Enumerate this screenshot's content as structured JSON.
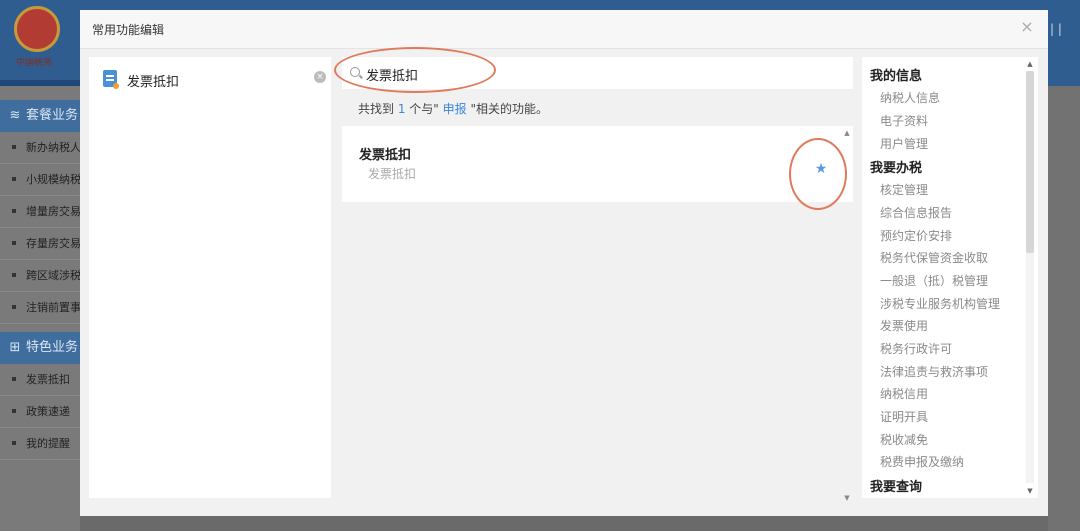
{
  "background": {
    "logo_text": "中国税务",
    "sections": [
      {
        "label": "套餐业务",
        "icon": "stack-icon"
      },
      {
        "label": "特色业务",
        "icon": "grid-icon"
      }
    ],
    "items_group1": [
      "新办纳税人",
      "小规模纳税",
      "增量房交易",
      "存量房交易",
      "跨区域涉税",
      "注销前置事"
    ],
    "items_group2": [
      "发票抵扣",
      "政策速递",
      "我的提醒"
    ]
  },
  "modal": {
    "title": "常用功能编辑",
    "close_icon": "×"
  },
  "favorites": [
    {
      "label": "发票抵扣",
      "icon": "document-icon"
    }
  ],
  "search": {
    "value": "发票抵扣"
  },
  "result_summary": {
    "prefix": "共找到 ",
    "count": "1",
    "middle": " 个与\" ",
    "keyword": "申报",
    "suffix": " \"相关的功能。"
  },
  "results": [
    {
      "title": "发票抵扣",
      "subtitle": "发票抵扣",
      "icon": "star-icon"
    }
  ],
  "categories": [
    {
      "heading": "我的信息",
      "items": [
        "纳税人信息",
        "电子资料",
        "用户管理"
      ]
    },
    {
      "heading": "我要办税",
      "items": [
        "核定管理",
        "综合信息报告",
        "预约定价安排",
        "税务代保管资金收取",
        "一般退（抵）税管理",
        "涉税专业服务机构管理",
        "发票使用",
        "税务行政许可",
        "法律追责与救济事项",
        "纳税信用",
        "证明开具",
        "税收减免",
        "税费申报及缴纳"
      ]
    },
    {
      "heading": "我要查询",
      "items": []
    }
  ],
  "colors": {
    "accent": "#3b86d8",
    "highlight_oval": "#e07a5a",
    "star": "#5b9ae0"
  }
}
